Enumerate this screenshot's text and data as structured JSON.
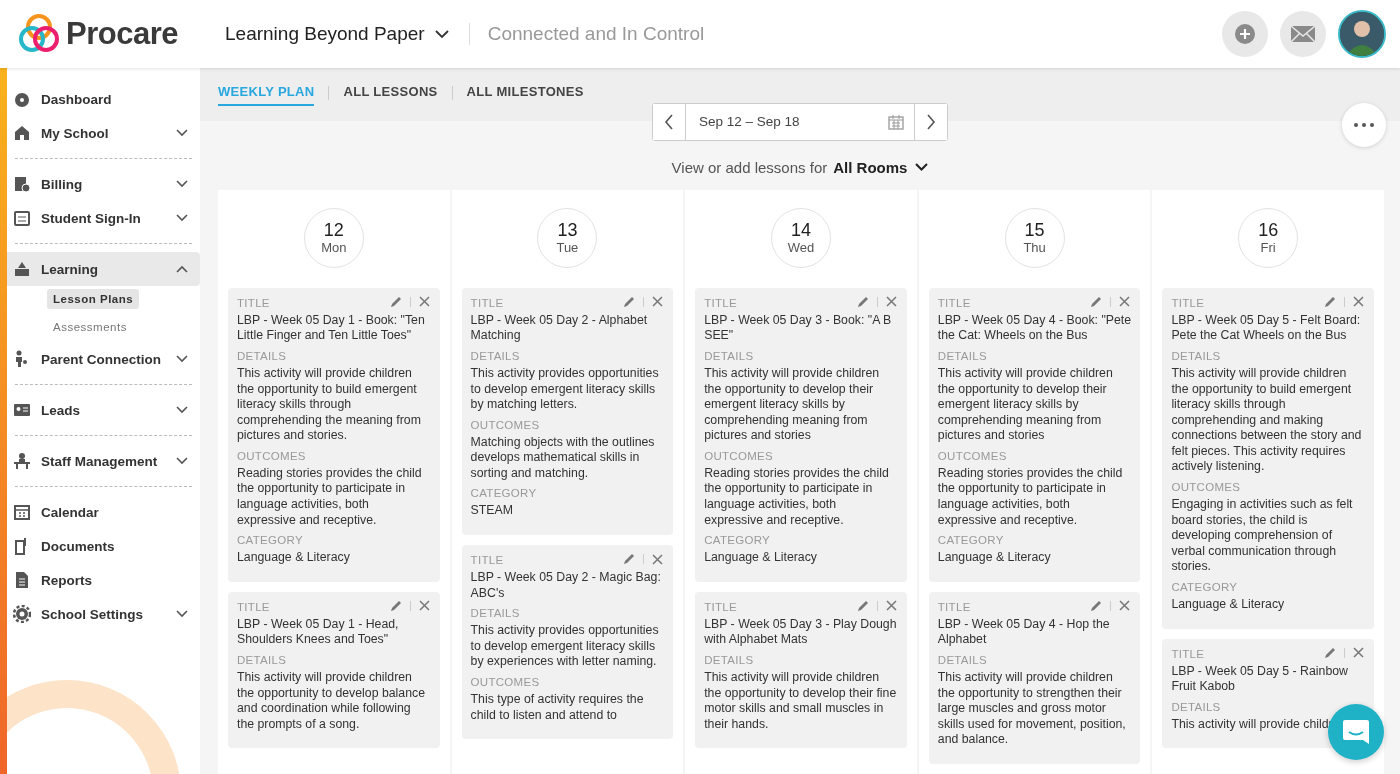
{
  "header": {
    "brand": "Procare",
    "school": "Learning Beyond Paper",
    "tagline": "Connected and In Control"
  },
  "sidebar": {
    "sections": [
      [
        {
          "label": "Dashboard",
          "selected": false
        },
        {
          "label": "My School",
          "expanded": false,
          "selected": false
        }
      ],
      [
        {
          "label": "Billing",
          "expanded": false,
          "selected": false
        },
        {
          "label": "Student Sign-In",
          "expanded": false,
          "selected": false
        }
      ],
      [
        {
          "label": "Learning",
          "expanded": true,
          "selected": true,
          "children": [
            {
              "label": "Lesson Plans",
              "selected": true
            },
            {
              "label": "Assessments",
              "selected": false
            }
          ]
        },
        {
          "label": "Parent Connection",
          "expanded": false,
          "selected": false
        }
      ],
      [
        {
          "label": "Leads",
          "expanded": false,
          "selected": false
        }
      ],
      [
        {
          "label": "Staff Management",
          "expanded": false,
          "selected": false
        }
      ],
      [
        {
          "label": "Calendar",
          "selected": false
        },
        {
          "label": "Documents",
          "selected": false
        },
        {
          "label": "Reports",
          "selected": false
        },
        {
          "label": "School Settings",
          "expanded": false,
          "selected": false
        }
      ]
    ]
  },
  "tabs": [
    {
      "label": "WEEKLY PLAN",
      "selected": true
    },
    {
      "label": "ALL LESSONS",
      "selected": false
    },
    {
      "label": "ALL MILESTONES",
      "selected": false
    }
  ],
  "date_range": "Sep 12 – Sep 18",
  "room_filter": {
    "prefix": "View or add lessons for",
    "value": "All Rooms"
  },
  "days": [
    {
      "date": "12",
      "weekday": "Mon",
      "lessons": [
        {
          "fields": [
            {
              "label": "TITLE",
              "text": "LBP - Week 05 Day 1 - Book: \"Ten Little Finger and Ten Little Toes\""
            },
            {
              "label": "DETAILS",
              "text": "This activity will provide children the opportunity to build emergent literacy skills through comprehending the meaning from pictures and stories."
            },
            {
              "label": "OUTCOMES",
              "text": "Reading stories provides the child the opportunity to participate in language activities, both expressive and receptive."
            },
            {
              "label": "CATEGORY",
              "text": "Language & Literacy"
            }
          ]
        },
        {
          "fields": [
            {
              "label": "TITLE",
              "text": "LBP - Week 05 Day 1 - Head, Shoulders Knees and Toes\""
            },
            {
              "label": "DETAILS",
              "text": "This activity will provide children the opportunity to develop balance and coordination while following the prompts of a song."
            }
          ]
        }
      ]
    },
    {
      "date": "13",
      "weekday": "Tue",
      "lessons": [
        {
          "fields": [
            {
              "label": "TITLE",
              "text": "LBP - Week 05 Day 2 - Alphabet Matching"
            },
            {
              "label": "DETAILS",
              "text": "This activity provides opportunities to develop emergent literacy skills by matching letters."
            },
            {
              "label": "OUTCOMES",
              "text": "Matching objects with the outlines develops mathematical skills in sorting and matching."
            },
            {
              "label": "CATEGORY",
              "text": "STEAM"
            }
          ]
        },
        {
          "fields": [
            {
              "label": "TITLE",
              "text": "LBP - Week 05 Day 2 - Magic Bag: ABC's"
            },
            {
              "label": "DETAILS",
              "text": "This activity provides opportunities to develop emergent literacy skills by experiences with letter naming."
            },
            {
              "label": "OUTCOMES",
              "text": "This type of activity requires the child to listen and attend to"
            }
          ]
        }
      ]
    },
    {
      "date": "14",
      "weekday": "Wed",
      "lessons": [
        {
          "fields": [
            {
              "label": "TITLE",
              "text": "LBP - Week 05 Day 3 - Book: \"A B SEE\""
            },
            {
              "label": "DETAILS",
              "text": "This activity will provide children the opportunity to develop their emergent literacy skills by comprehending meaning from pictures and stories"
            },
            {
              "label": "OUTCOMES",
              "text": "Reading stories provides the child the opportunity to participate in language activities, both expressive and receptive."
            },
            {
              "label": "CATEGORY",
              "text": "Language & Literacy"
            }
          ]
        },
        {
          "fields": [
            {
              "label": "TITLE",
              "text": "LBP - Week 05 Day 3 - Play Dough with Alphabet Mats"
            },
            {
              "label": "DETAILS",
              "text": "This activity will provide children the opportunity to develop their fine motor skills and small muscles in their hands."
            }
          ]
        }
      ]
    },
    {
      "date": "15",
      "weekday": "Thu",
      "lessons": [
        {
          "fields": [
            {
              "label": "TITLE",
              "text": "LBP - Week 05 Day 4 - Book: \"Pete the Cat: Wheels on the Bus"
            },
            {
              "label": "DETAILS",
              "text": "This activity will provide children the opportunity to develop their emergent literacy skills by comprehending meaning from pictures and stories"
            },
            {
              "label": "OUTCOMES",
              "text": "Reading stories provides the child the opportunity to participate in language activities, both expressive and receptive."
            },
            {
              "label": "CATEGORY",
              "text": "Language & Literacy"
            }
          ]
        },
        {
          "fields": [
            {
              "label": "TITLE",
              "text": "LBP - Week 05 Day 4 - Hop the Alphabet"
            },
            {
              "label": "DETAILS",
              "text": "This activity will provide children the opportunity to strengthen their large muscles and gross motor skills used for movement, position, and balance."
            }
          ]
        }
      ]
    },
    {
      "date": "16",
      "weekday": "Fri",
      "lessons": [
        {
          "fields": [
            {
              "label": "TITLE",
              "text": "LBP - Week 05 Day 5 - Felt Board: Pete the Cat Wheels on the Bus"
            },
            {
              "label": "DETAILS",
              "text": "This activity will provide children the opportunity to build emergent literacy skills through comprehending and making connections between the story and felt pieces. This activity requires actively listening."
            },
            {
              "label": "OUTCOMES",
              "text": "Engaging in activities such as felt board stories, the child is developing comprehension of verbal communication through stories."
            },
            {
              "label": "CATEGORY",
              "text": "Language & Literacy"
            }
          ]
        },
        {
          "fields": [
            {
              "label": "TITLE",
              "text": "LBP - Week 05 Day 5 - Rainbow Fruit Kabob"
            },
            {
              "label": "DETAILS",
              "text": "This activity will provide childr"
            }
          ]
        }
      ]
    }
  ]
}
